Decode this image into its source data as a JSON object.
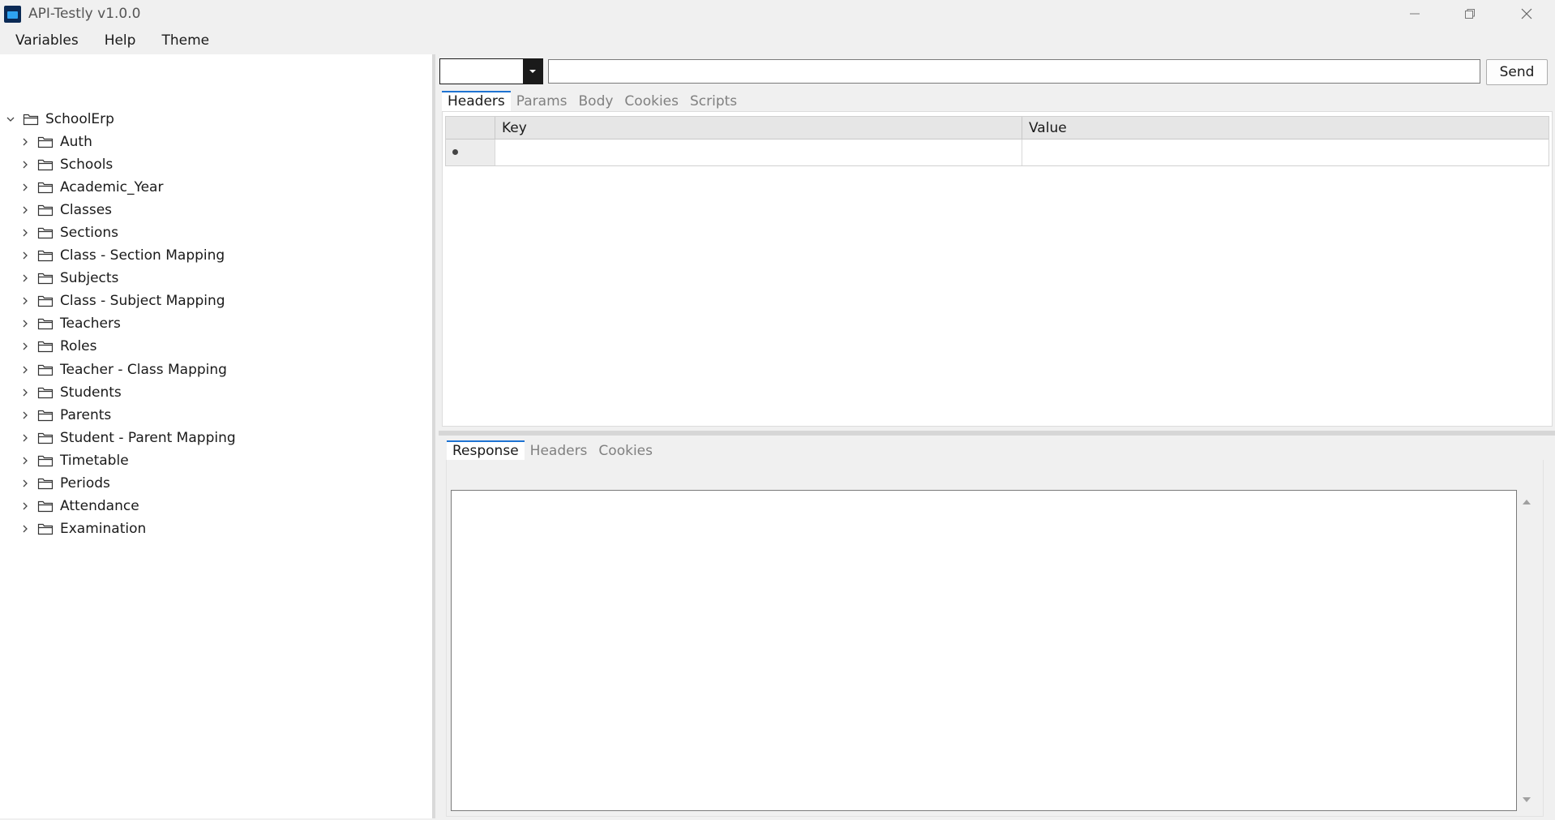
{
  "window": {
    "title": "API-Testly v1.0.0"
  },
  "menu": [
    "Variables",
    "Help",
    "Theme"
  ],
  "tree": {
    "root": "SchoolErp",
    "children": [
      "Auth",
      "Schools",
      "Academic_Year",
      "Classes",
      "Sections",
      "Class - Section Mapping",
      "Subjects",
      "Class - Subject Mapping",
      "Teachers",
      "Roles",
      "Teacher - Class Mapping",
      "Students",
      "Parents",
      "Student - Parent Mapping",
      "Timetable",
      "Periods",
      "Attendance",
      "Examination"
    ]
  },
  "request": {
    "method": "",
    "url": "",
    "send_label": "Send",
    "tabs": [
      "Headers",
      "Params",
      "Body",
      "Cookies",
      "Scripts"
    ],
    "active_tab": "Headers",
    "grid": {
      "columns": [
        "Key",
        "Value"
      ]
    }
  },
  "response": {
    "tabs": [
      "Response",
      "Headers",
      "Cookies"
    ],
    "active_tab": "Response",
    "body": ""
  },
  "colors": {
    "accent": "#1e73d2",
    "app_icon": "#0b2a55"
  },
  "icons": {
    "app": "app-logo-icon",
    "minimize": "minimize-icon",
    "restore": "restore-icon",
    "close": "close-icon",
    "folder": "folder-icon",
    "chevron_down": "chevron-down-icon",
    "chevron_right": "chevron-right-icon"
  }
}
